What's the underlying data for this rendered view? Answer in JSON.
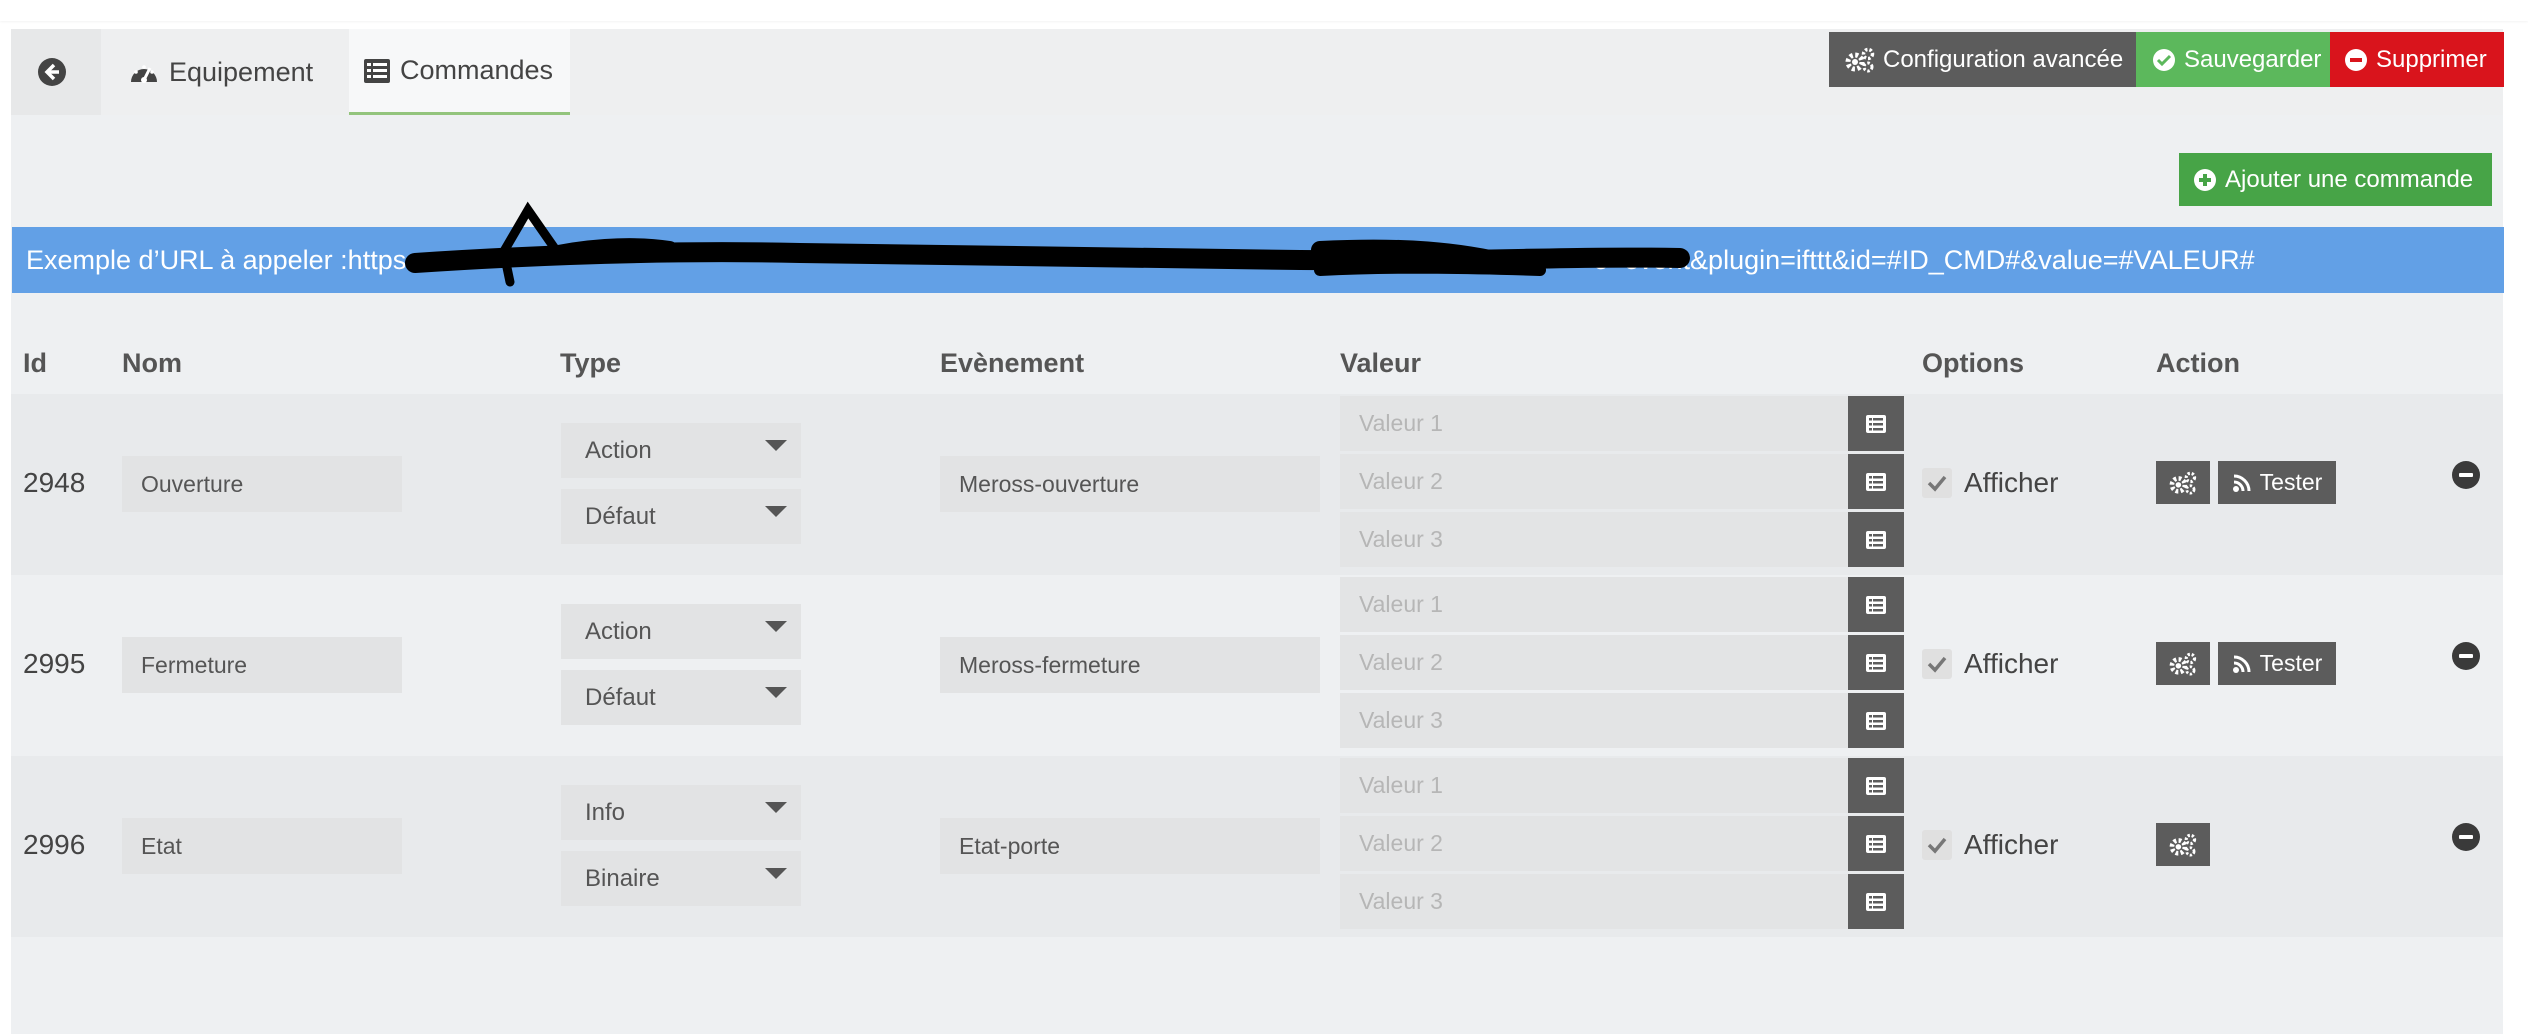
{
  "tabs": {
    "back_icon": "arrow-circle-left-icon",
    "equipement": "Equipement",
    "commandes": "Commandes"
  },
  "toolbar": {
    "config": "Configuration avancée",
    "save": "Sauvegarder",
    "delete": "Supprimer",
    "add_command": "Ajouter une commande"
  },
  "url_example": {
    "label": "Exemple d’URL à appeler : ",
    "visible_start": "https",
    "visible_end": "e=event&plugin=ifttt&id=#ID_CMD#&value=#VALEUR#"
  },
  "columns": {
    "id": "Id",
    "nom": "Nom",
    "type": "Type",
    "evenement": "Evènement",
    "valeur": "Valeur",
    "options": "Options",
    "action": "Action"
  },
  "rows": [
    {
      "id": "2948",
      "nom": "Ouverture",
      "type": "Action",
      "subtype": "Défaut",
      "evenement": "Meross-ouverture",
      "valeurs": [
        "Valeur 1",
        "Valeur 2",
        "Valeur 3"
      ],
      "afficher": "Afficher",
      "tester": "Tester"
    },
    {
      "id": "2995",
      "nom": "Fermeture",
      "type": "Action",
      "subtype": "Défaut",
      "evenement": "Meross-fermeture",
      "valeurs": [
        "Valeur 1",
        "Valeur 2",
        "Valeur 3"
      ],
      "afficher": "Afficher",
      "tester": "Tester"
    },
    {
      "id": "2996",
      "nom": "Etat",
      "type": "Info",
      "subtype": "Binaire",
      "evenement": "Etat-porte",
      "valeurs": [
        "Valeur 1",
        "Valeur 2",
        "Valeur 3"
      ],
      "afficher": "Afficher"
    }
  ],
  "colors": {
    "url_bar": "#62a0e6",
    "save": "#5cb85c",
    "delete": "#d9141c",
    "add": "#47a447",
    "dark_button": "#5c5c5c",
    "tab_active_underline": "#93c47d"
  }
}
